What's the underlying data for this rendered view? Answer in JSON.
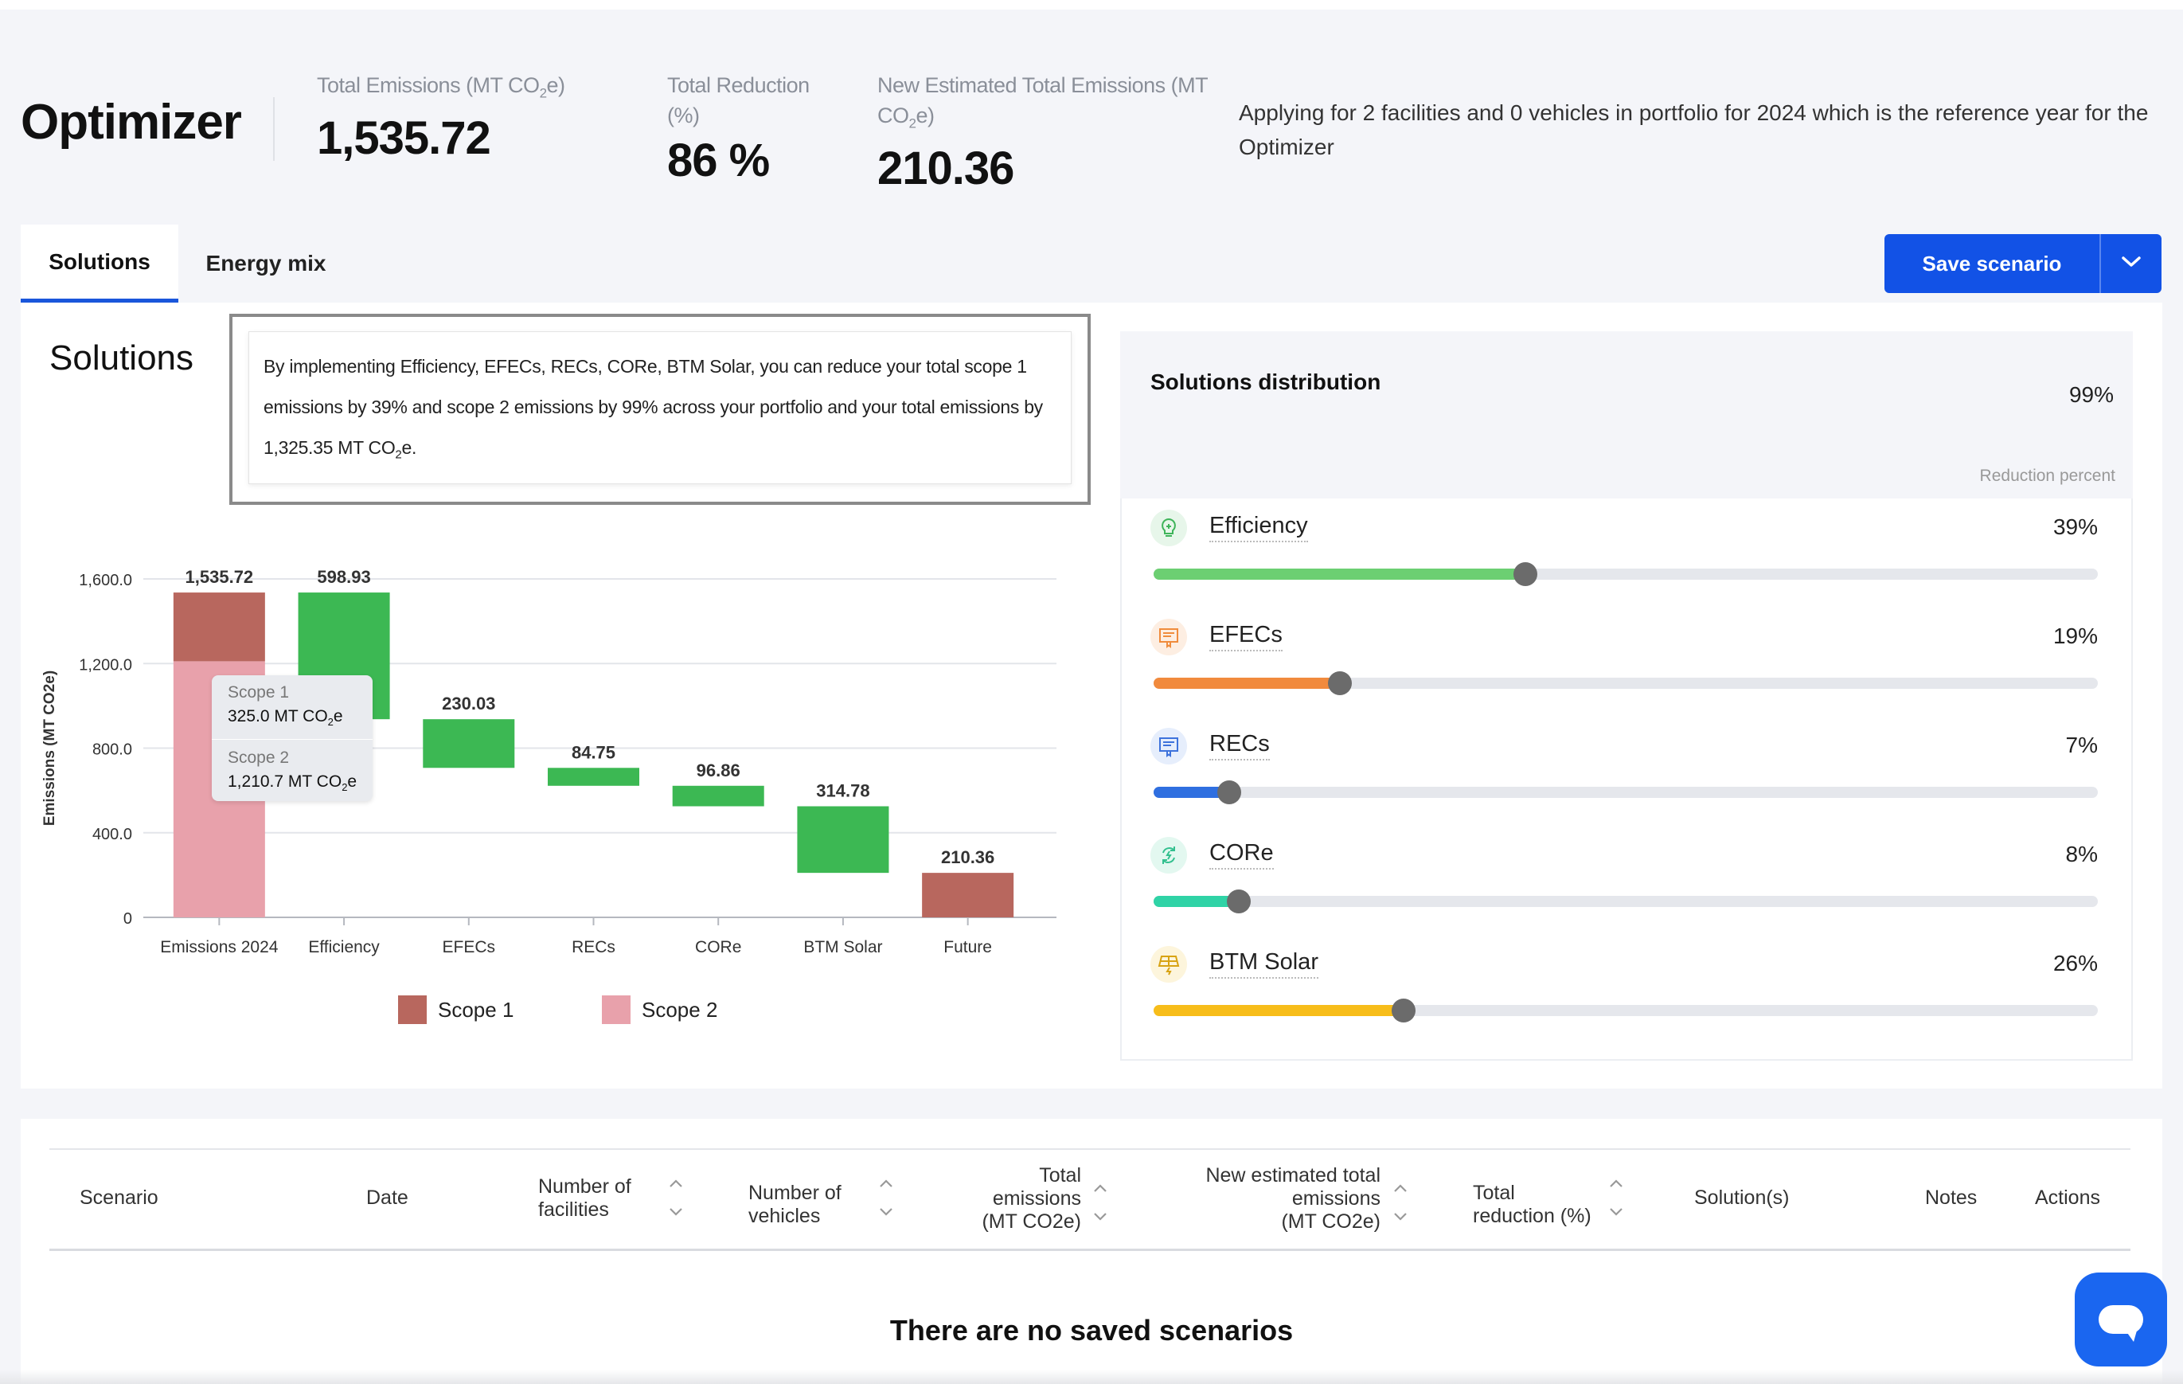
{
  "header": {
    "title": "Optimizer",
    "metrics": [
      {
        "label_pre": "Total Emissions (MT CO",
        "label_sub": "2",
        "label_post": "e)",
        "value": "1,535.72"
      },
      {
        "label_pre": "Total Reduction (%)",
        "label_sub": "",
        "label_post": "",
        "value": "86 %"
      },
      {
        "label_pre": "New Estimated Total Emissions (MT CO",
        "label_sub": "2",
        "label_post": "e)",
        "value": "210.36"
      }
    ],
    "note": "Applying for 2 facilities and 0 vehicles in portfolio for 2024 which is the reference year for the Optimizer"
  },
  "tabs": [
    {
      "label": "Solutions",
      "active": true
    },
    {
      "label": "Energy mix",
      "active": false
    }
  ],
  "actions": {
    "save_label": "Save scenario"
  },
  "solutions": {
    "title": "Solutions",
    "summary_pre": "By implementing Efficiency, EFECs, RECs, CORe, BTM Solar, you can reduce your total scope 1 emissions by 39% and scope 2 emissions by 99% across your portfolio and your total emissions by 1,325.35 MT CO",
    "summary_sub": "2",
    "summary_post": "e."
  },
  "tooltip": {
    "scope1_label": "Scope 1",
    "scope1_value_pre": "325.0 MT CO",
    "scope1_value_sub": "2",
    "scope1_value_post": "e",
    "scope2_label": "Scope 2",
    "scope2_value_pre": "1,210.7 MT CO",
    "scope2_value_sub": "2",
    "scope2_value_post": "e"
  },
  "chart_data": {
    "type": "bar",
    "subtype": "waterfall",
    "ylabel": "Emissions (MT CO2e)",
    "ylim": [
      0,
      1600
    ],
    "yticks": [
      "0",
      "400.0",
      "800.0",
      "1,200.0",
      "1,600.0"
    ],
    "categories": [
      "Emissions 2024",
      "Efficiency",
      "EFECs",
      "RECs",
      "CORe",
      "BTM Solar",
      "Future"
    ],
    "data_labels": [
      "1,535.72",
      "598.93",
      "230.03",
      "84.75",
      "96.86",
      "314.78",
      "210.36"
    ],
    "bars": [
      {
        "category": "Emissions 2024",
        "kind": "stack",
        "scope1": 325.0,
        "scope2": 1210.7
      },
      {
        "category": "Efficiency",
        "kind": "reduction",
        "from": 1535.72,
        "to": 936.79
      },
      {
        "category": "EFECs",
        "kind": "reduction",
        "from": 936.79,
        "to": 706.76
      },
      {
        "category": "RECs",
        "kind": "reduction",
        "from": 706.76,
        "to": 622.01
      },
      {
        "category": "CORe",
        "kind": "reduction",
        "from": 622.01,
        "to": 525.15
      },
      {
        "category": "BTM Solar",
        "kind": "reduction",
        "from": 525.15,
        "to": 210.37
      },
      {
        "category": "Future",
        "kind": "total",
        "value": 210.36
      }
    ],
    "legend": [
      {
        "name": "Scope 1",
        "color": "#b8675e"
      },
      {
        "name": "Scope 2",
        "color": "#e8a1ab"
      }
    ],
    "reduction_color": "#3cb853"
  },
  "distribution": {
    "title": "Solutions distribution",
    "total": "99%",
    "subtitle": "Reduction percent",
    "items": [
      {
        "name": "Efficiency",
        "pct_label": "39%",
        "value": 0.394,
        "color": "#6ccf72",
        "icon": "lightbulb-icon",
        "icon_bg": "#e7f6ea",
        "icon_color": "#3fb45a"
      },
      {
        "name": "EFECs",
        "pct_label": "19%",
        "value": 0.197,
        "color": "#f18a3d",
        "icon": "certificate-icon",
        "icon_bg": "#fdeee2",
        "icon_color": "#f08c3c"
      },
      {
        "name": "RECs",
        "pct_label": "7%",
        "value": 0.08,
        "color": "#2f6fe0",
        "icon": "certificate-icon",
        "icon_bg": "#e6eefc",
        "icon_color": "#3d72dc"
      },
      {
        "name": "CORe",
        "pct_label": "8%",
        "value": 0.09,
        "color": "#2fd3a6",
        "icon": "recycle-icon",
        "icon_bg": "#e3f8f0",
        "icon_color": "#33c08f"
      },
      {
        "name": "BTM Solar",
        "pct_label": "26%",
        "value": 0.265,
        "color": "#f7bd1a",
        "icon": "solar-panel-icon",
        "icon_bg": "#fdf5dc",
        "icon_color": "#d8a313"
      }
    ]
  },
  "scenarios_table": {
    "columns": {
      "scenario": "Scenario",
      "date": "Date",
      "facilities_1": "Number of",
      "facilities_2": "facilities",
      "vehicles_1": "Number of",
      "vehicles_2": "vehicles",
      "total_1": "Total",
      "total_2": "emissions",
      "total_3": "(MT CO2e)",
      "newest_1": "New estimated total",
      "newest_2": "emissions",
      "newest_3": "(MT CO2e)",
      "reduction_1": "Total",
      "reduction_2": "reduction (%)",
      "solutions": "Solution(s)",
      "notes": "Notes",
      "actions": "Actions"
    },
    "empty_message": "There are no saved scenarios"
  }
}
